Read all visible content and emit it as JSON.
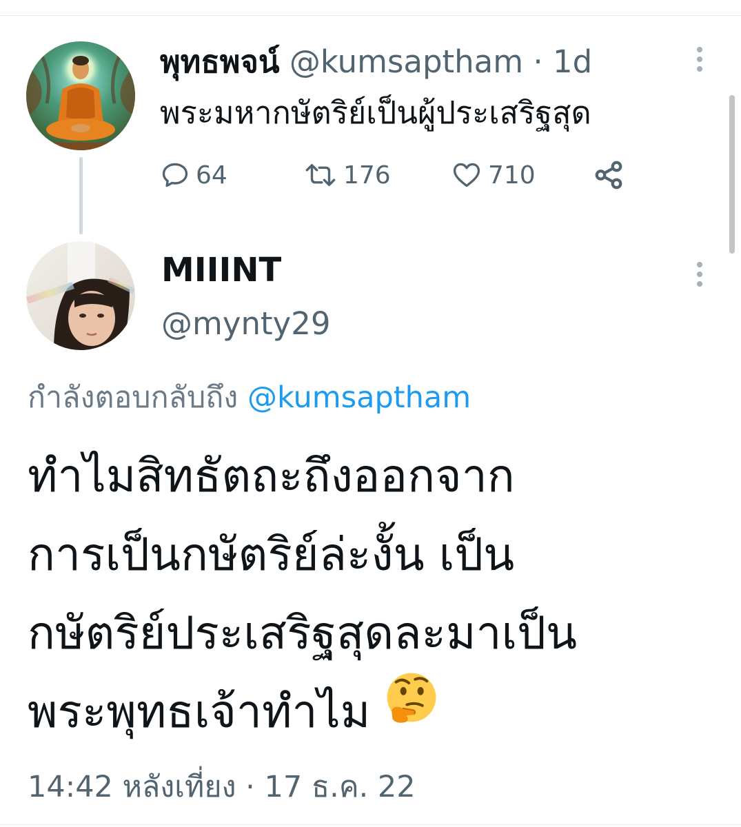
{
  "parent_tweet": {
    "display_name": "พุทธพจน์",
    "handle": "@kumsaptham",
    "separator": "·",
    "time": "1d",
    "text": "พระมหากษัตริย์เป็นผู้ประเสริฐสุด",
    "reply_count": "64",
    "retweet_count": "176",
    "like_count": "710",
    "avatar": "buddha-painting-avatar"
  },
  "reply_tweet": {
    "display_name": "MIIINT",
    "handle": "@mynty29",
    "replying_prefix": "กำลังตอบกลับถึง",
    "replying_handle": "@kumsaptham",
    "text_lines": [
      "ทำไมสิทธัตถะถึงออกจาก",
      "การเป็นกษัตริย์ล่ะงั้น เป็น",
      "กษัตริย์ประเสริฐสุดละมาเป็น",
      "พระพุทธเจ้าทำไม"
    ],
    "emoji": "thinking-face",
    "timestamp": "14:42 หลังเที่ยง · 17 ธ.ค. 22",
    "avatar": "user-photo-avatar"
  },
  "icons": {
    "reply": "speech-bubble-icon",
    "retweet": "retweet-arrows-icon",
    "like": "heart-icon",
    "share": "share-icon",
    "more": "vertical-dots-icon"
  },
  "colors": {
    "text_primary": "#0f1419",
    "text_secondary": "#536471",
    "link": "#1d9bf0",
    "thread_line": "#cfd9de"
  }
}
